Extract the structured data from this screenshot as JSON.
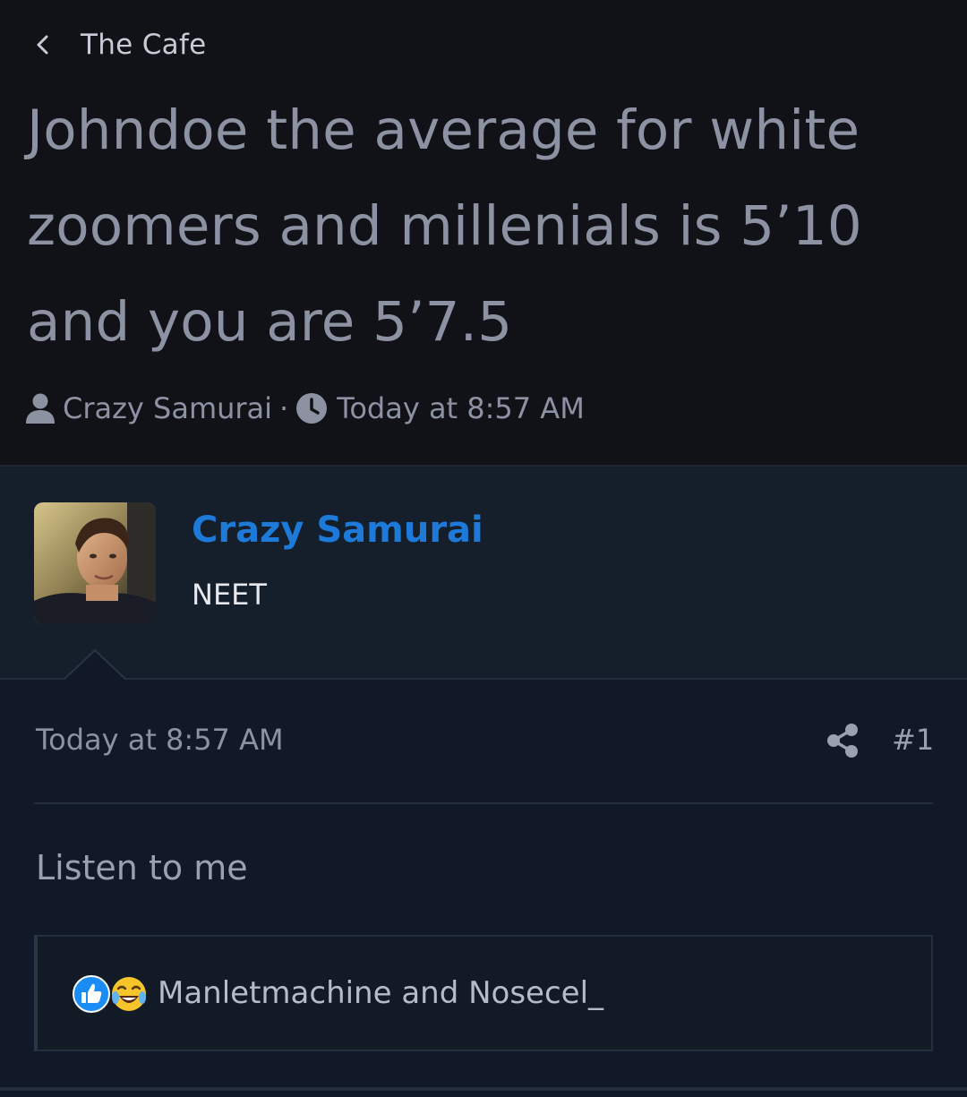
{
  "breadcrumb": {
    "label": "The Cafe",
    "icon": "chevron-left-icon"
  },
  "thread": {
    "title": "Johndoe the average for white zoomers and millenials is 5’10 and you are 5’7.5",
    "author": "Crazy Samurai",
    "separator": "·",
    "time": "Today at 8:57 AM"
  },
  "post": {
    "username": "Crazy Samurai",
    "user_title": "NEET",
    "date": "Today at 8:57 AM",
    "number": "#1",
    "body": "Listen to me",
    "reactions": {
      "icons": [
        "like-icon",
        "laugh-icon"
      ],
      "text": "Manletmachine and Nosecel_"
    }
  },
  "colors": {
    "header_bg": "#111217",
    "page_bg": "#121926",
    "username": "#1e7ad9",
    "muted_text": "#8d92a3"
  }
}
